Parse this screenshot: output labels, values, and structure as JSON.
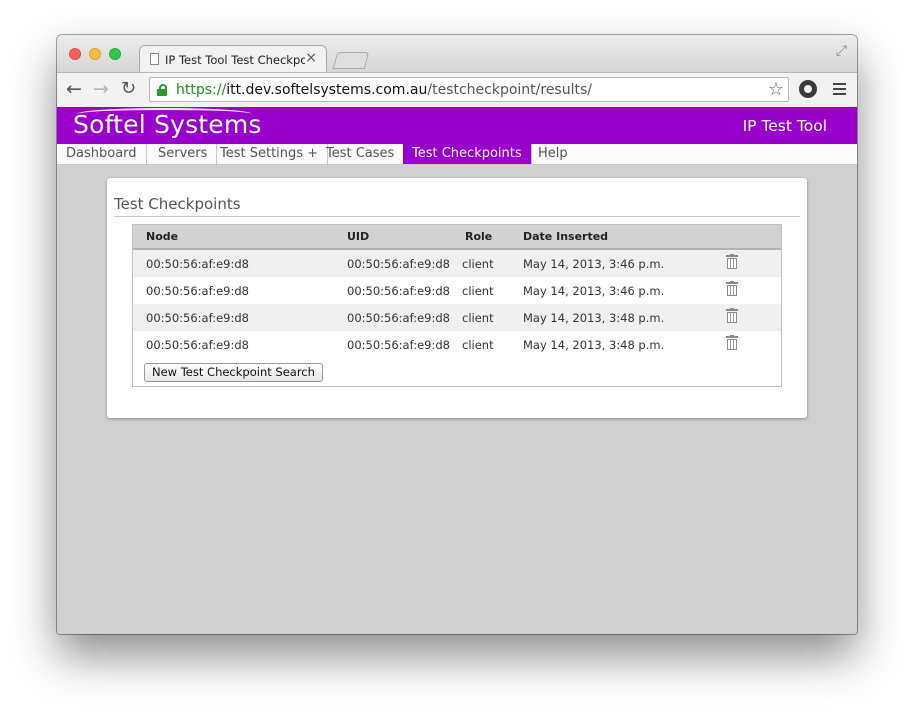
{
  "browser": {
    "tab_title": "IP Test Tool Test Checkpoints",
    "tab_close": "×",
    "url_scheme": "https://",
    "url_host": "itt.dev.softelsystems.com.au",
    "url_path": "/testcheckpoint/results/",
    "back_glyph": "←",
    "forward_glyph": "→",
    "reload_glyph": "↻",
    "star_glyph": "☆",
    "fullscreen_glyph": "⤢"
  },
  "site": {
    "logo": "Softel Systems",
    "app_title": "IP Test Tool",
    "brand_color": "#9900cc"
  },
  "menu": [
    {
      "label": "Dashboard"
    },
    {
      "label": "Servers"
    },
    {
      "label": "Test Settings +"
    },
    {
      "label": "Test Cases"
    },
    {
      "label": "Test Checkpoints",
      "active": true
    },
    {
      "label": "Help"
    }
  ],
  "content": {
    "heading": "Test Checkpoints",
    "columns": [
      "Node",
      "UID",
      "Role",
      "Date Inserted"
    ],
    "rows": [
      {
        "node": "00:50:56:af:e9:d8",
        "uid": "00:50:56:af:e9:d8",
        "role": "client",
        "date": "May 14, 2013, 3:46 p.m."
      },
      {
        "node": "00:50:56:af:e9:d8",
        "uid": "00:50:56:af:e9:d8",
        "role": "client",
        "date": "May 14, 2013, 3:46 p.m."
      },
      {
        "node": "00:50:56:af:e9:d8",
        "uid": "00:50:56:af:e9:d8",
        "role": "client",
        "date": "May 14, 2013, 3:48 p.m."
      },
      {
        "node": "00:50:56:af:e9:d8",
        "uid": "00:50:56:af:e9:d8",
        "role": "client",
        "date": "May 14, 2013, 3:48 p.m."
      }
    ],
    "new_search_button": "New Test Checkpoint Search"
  }
}
